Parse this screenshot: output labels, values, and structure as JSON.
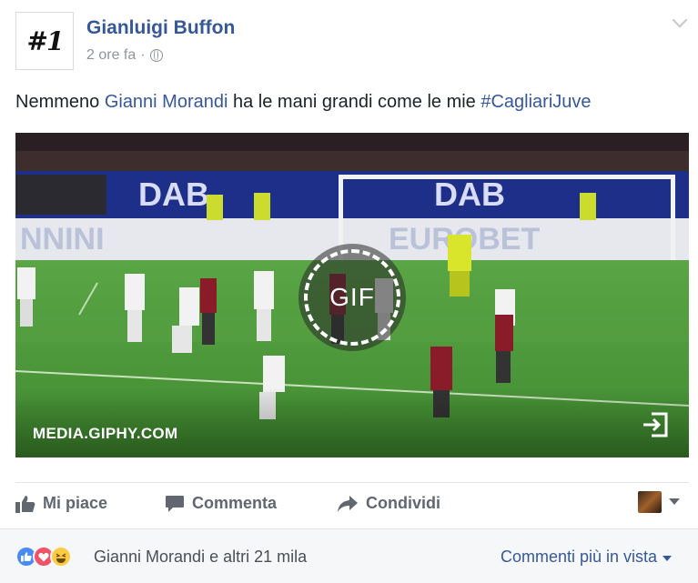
{
  "post": {
    "author": "Gianluigi Buffon",
    "avatar_text": "#1",
    "time": "2 ore fa",
    "separator": "·",
    "text_prefix": "Nemmeno ",
    "mention": "Gianni Morandi",
    "text_middle": " ha le mani grandi come le mie ",
    "hashtag": "#CagliariJuve"
  },
  "media": {
    "source": "MEDIA.GIPHY.COM",
    "gif_label": "GIF",
    "banner_left": "DAB",
    "banner_right": "DAB",
    "board_left": "NNINI",
    "board_right": "EUROBET"
  },
  "actions": {
    "like": "Mi piace",
    "comment": "Commenta",
    "share": "Condividi"
  },
  "footer": {
    "reactions_text": "Gianni Morandi e altri 21 mila",
    "sort_label": "Commenti più in vista"
  },
  "colors": {
    "link": "#365899",
    "action_gray": "#606770",
    "pitch": "#4f9a3c"
  }
}
